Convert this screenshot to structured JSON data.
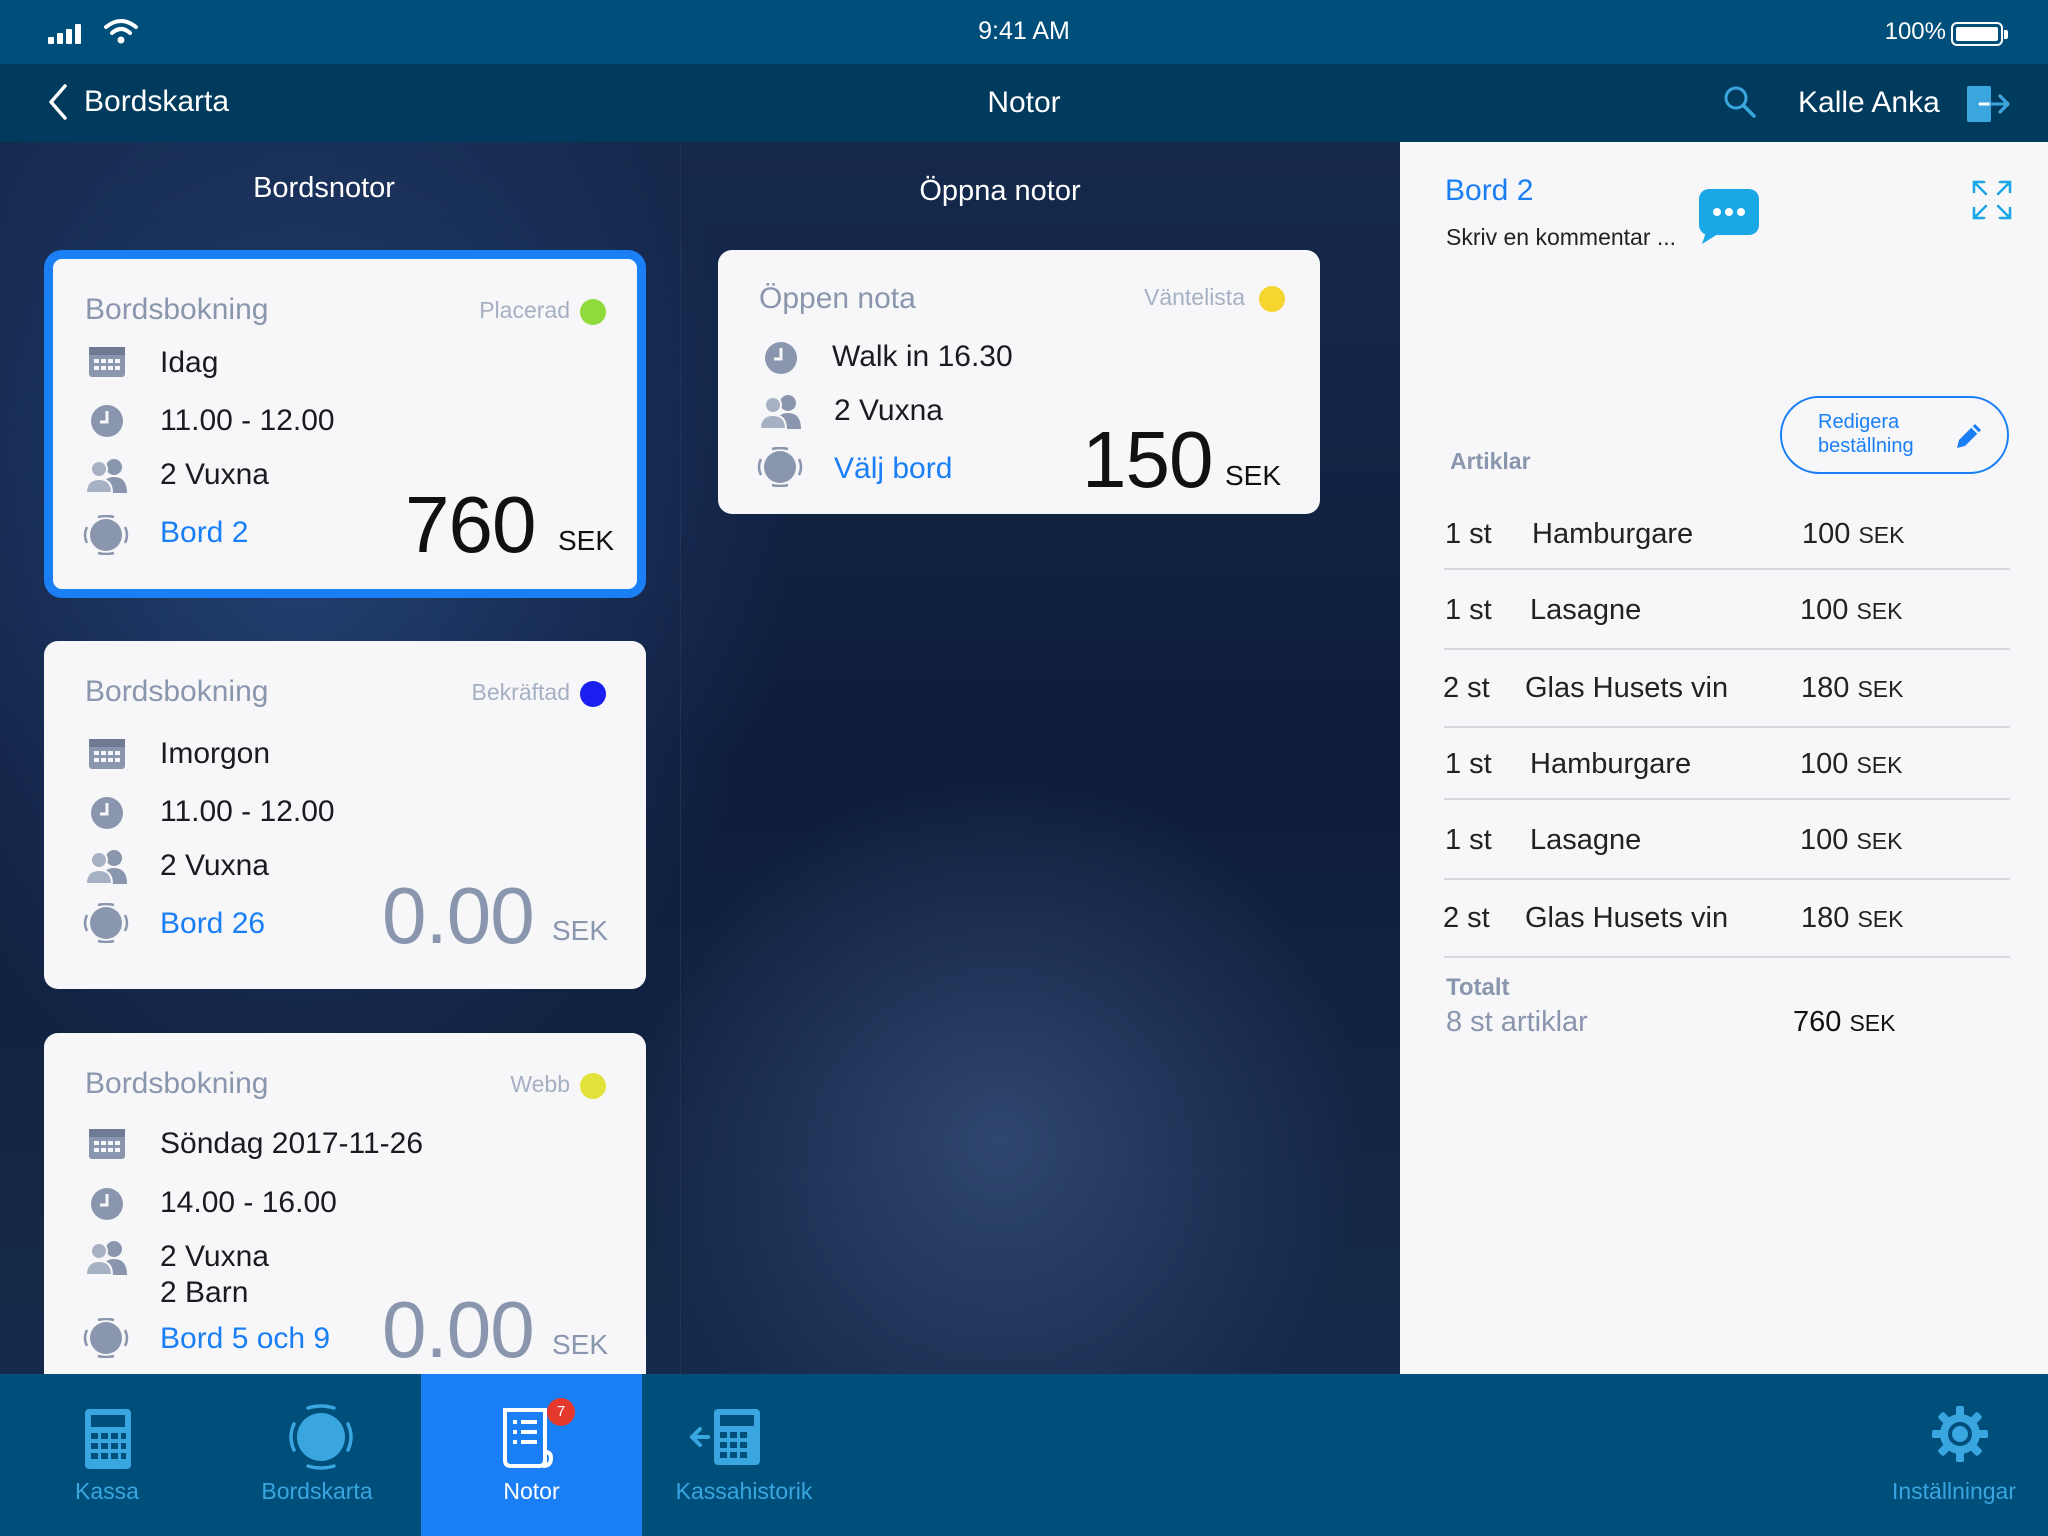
{
  "status_bar": {
    "time": "9:41 AM",
    "battery": "100%"
  },
  "nav": {
    "back_label": "Bordskarta",
    "title": "Notor",
    "user": "Kalle Anka"
  },
  "columns": {
    "left_title": "Bordsnotor",
    "middle_title": "Öppna notor"
  },
  "bordsnotor": [
    {
      "kind": "Bordsbokning",
      "status": "Placerad",
      "status_color": "#8fdb3c",
      "date": "Idag",
      "time": "11.00 - 12.00",
      "guests": "2 Vuxna",
      "table": "Bord 2",
      "amount": "760",
      "currency": "SEK"
    },
    {
      "kind": "Bordsbokning",
      "status": "Bekräftad",
      "status_color": "#1a1ff0",
      "date": "Imorgon",
      "time": "11.00 - 12.00",
      "guests": "2 Vuxna",
      "table": "Bord 26",
      "amount": "0.00",
      "currency": "SEK"
    },
    {
      "kind": "Bordsbokning",
      "status": "Webb",
      "status_color": "#e1e23a",
      "date": "Söndag 2017-11-26",
      "time": "14.00 - 16.00",
      "guests": "2 Vuxna",
      "guests_extra": "2 Barn",
      "table": "Bord 5 och 9",
      "amount": "0.00",
      "currency": "SEK"
    }
  ],
  "oppna_notor": [
    {
      "kind": "Öppen nota",
      "status": "Väntelista",
      "status_color": "#f6d52e",
      "time": "Walk in 16.30",
      "guests": "2 Vuxna",
      "table_action": "Välj bord",
      "amount": "150",
      "currency": "SEK"
    }
  ],
  "detail": {
    "title": "Bord 2",
    "comment_placeholder": "Skriv en kommentar ...",
    "edit_button_line1": "Redigera",
    "edit_button_line2": "beställning",
    "articles_header": "Artiklar",
    "items": [
      {
        "qty": "1 st",
        "name": "Hamburgare",
        "price": "100",
        "currency": "SEK"
      },
      {
        "qty": "1 st",
        "name": "Lasagne",
        "price": "100",
        "currency": "SEK"
      },
      {
        "qty": "2 st",
        "name": "Glas Husets vin",
        "price": "180",
        "currency": "SEK"
      },
      {
        "qty": "1 st",
        "name": "Hamburgare",
        "price": "100",
        "currency": "SEK"
      },
      {
        "qty": "1 st",
        "name": "Lasagne",
        "price": "100",
        "currency": "SEK"
      },
      {
        "qty": "2 st",
        "name": "Glas Husets vin",
        "price": "180",
        "currency": "SEK"
      }
    ],
    "total_label": "Totalt",
    "total_count": "8 st  artiklar",
    "total_amount": "760",
    "total_currency": "SEK"
  },
  "tabs": [
    {
      "label": "Kassa",
      "icon": "calculator-icon"
    },
    {
      "label": "Bordskarta",
      "icon": "table-icon"
    },
    {
      "label": "Notor",
      "icon": "receipt-icon",
      "badge": "7",
      "active": true
    },
    {
      "label": "Kassahistorik",
      "icon": "history-icon"
    },
    {
      "label": "Inställningar",
      "icon": "gear-icon"
    }
  ],
  "colors": {
    "accent": "#1a7ff5",
    "statusbar": "#004e7a",
    "navbar": "#003a5c",
    "tabbar": "#004f7b",
    "tab_icon": "#3aa6e0"
  }
}
